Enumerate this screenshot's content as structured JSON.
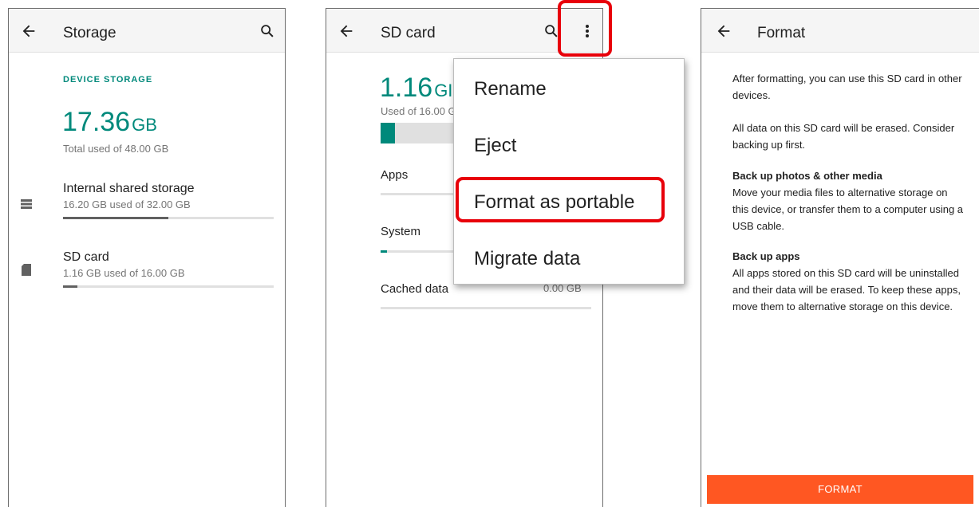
{
  "storage_screen": {
    "title": "Storage",
    "section_label": "DEVICE STORAGE",
    "used_value": "17.36",
    "used_unit": "GB",
    "total_label": "Total used of 48.00 GB",
    "items": [
      {
        "title": "Internal shared storage",
        "subtitle": "16.20 GB used of 32.00 GB",
        "usage_fraction": 0.5
      },
      {
        "title": "SD card",
        "subtitle": "1.16 GB used of 16.00 GB",
        "usage_fraction": 0.07
      }
    ]
  },
  "sd_card_screen": {
    "title": "SD card",
    "used_value": "1.16",
    "used_unit_partial": "GI",
    "used_label_partial": "Used of 16.00 G",
    "usage_fraction": 0.18,
    "categories": [
      {
        "label": "Apps",
        "value": ""
      },
      {
        "label": "System",
        "value": "",
        "usage_fraction": 0.03
      },
      {
        "label": "Cached data",
        "value": "0.00 GB"
      }
    ],
    "overflow_menu": {
      "items": [
        "Rename",
        "Eject",
        "Format as portable",
        "Migrate data"
      ]
    }
  },
  "format_screen": {
    "title": "Format",
    "intro": "After formatting, you can use this SD card in other devices.",
    "warning": "All data on this SD card will be erased. Consider backing up first.",
    "backup_media_heading": "Back up photos & other media",
    "backup_media_body": "Move your media files to alternative storage on this device, or transfer them to a computer using a USB cable.",
    "backup_apps_heading": "Back up apps",
    "backup_apps_body": "All apps stored on this SD card will be uninstalled and their data will be erased. To keep these apps, move them to alternative storage on this device.",
    "button_label": "FORMAT"
  },
  "colors": {
    "accent": "#00897b",
    "format_button": "#ff5722",
    "highlight": "#e8000a"
  }
}
